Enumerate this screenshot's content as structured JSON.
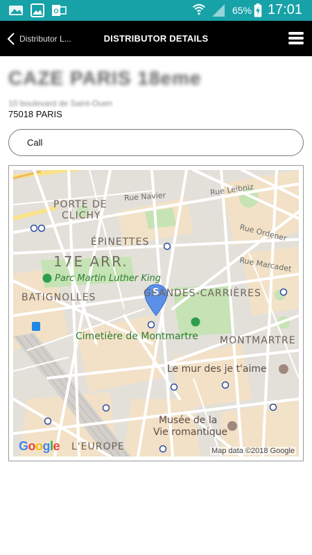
{
  "status_bar": {
    "battery_percent": "65%",
    "time": "17:01",
    "icons": [
      "gallery-notification-icon",
      "image-notification-icon",
      "outlook-notification-icon",
      "wifi-icon",
      "signal-icon",
      "battery-charging-icon"
    ]
  },
  "app_bar": {
    "back_label": "Distributor L...",
    "title": "DISTRIBUTOR DETAILS",
    "menu_icon": "hamburger-menu-icon"
  },
  "distributor": {
    "name": "CAZE PARIS 18eme",
    "street": "10 boulevard de Saint-Ouen",
    "city": "75018 PARIS"
  },
  "actions": {
    "call_label": "Call"
  },
  "map": {
    "labels": {
      "porte_de": "PORTE DE",
      "clichy": "CLICHY",
      "rue_navier": "Rue Navier",
      "rue_leibniz": "Rue Leibniz",
      "epinettes": "ÉPINETTES",
      "rue_ordener": "Rue Ordener",
      "arr17": "17E ARR.",
      "rue_marcadet": "Rue Marcadet",
      "parc": "Parc Martin Luther King",
      "batignolles": "BATIGNOLLES",
      "grandes_carrieres": "GRANDES-CARRIÈRES",
      "cimetiere": "Cimetière de Montmartre",
      "montmartre": "MONTMARTRE",
      "mur": "Le mur des je t'aime",
      "musee_line1": "Musée de la",
      "musee_line2": "Vie romantique",
      "europe": "L'EUROPE"
    },
    "marker_letter": "S",
    "attribution": "Map data ©2018 Google",
    "brand": "Google"
  }
}
